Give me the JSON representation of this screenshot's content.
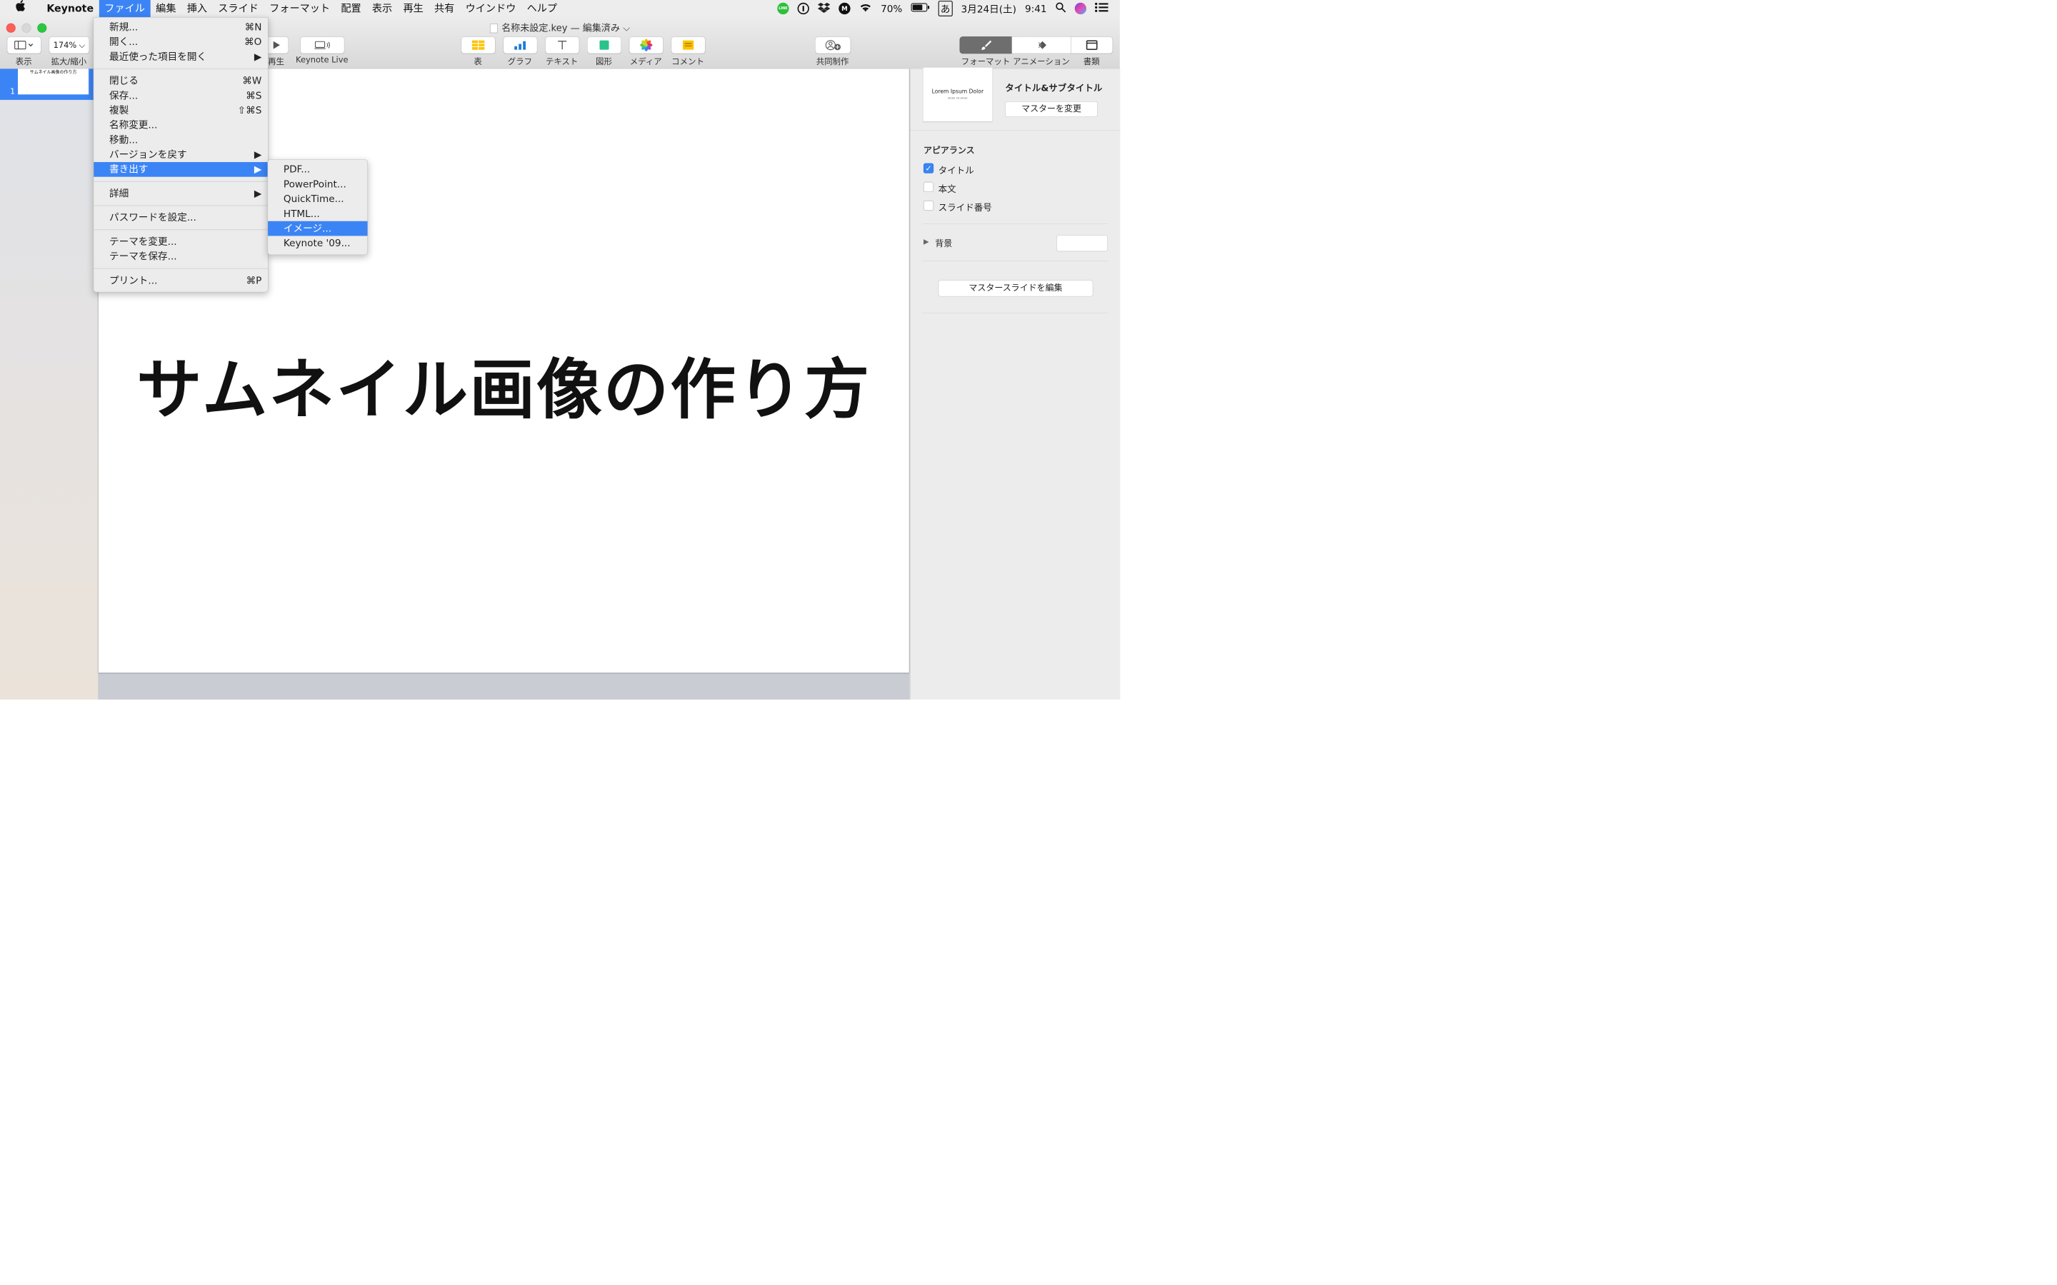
{
  "menubar": {
    "app": "Keynote",
    "items": [
      "ファイル",
      "編集",
      "挿入",
      "スライド",
      "フォーマット",
      "配置",
      "表示",
      "再生",
      "共有",
      "ウインドウ",
      "ヘルプ"
    ],
    "status": {
      "battery": "70%",
      "ime": "あ",
      "date": "3月24日(土)",
      "time": "9:41",
      "line_label": "LINE"
    }
  },
  "window": {
    "title": "名称未設定.key — 編集済み"
  },
  "toolbar": {
    "view_label": "表示",
    "zoom_value": "174%",
    "zoom_label": "拡大/縮小",
    "play_label": "再生",
    "keynote_live_label": "Keynote Live",
    "table_label": "表",
    "chart_label": "グラフ",
    "text_label": "テキスト",
    "shape_label": "図形",
    "media_label": "メディア",
    "comment_label": "コメント",
    "collab_label": "共同制作",
    "format_label": "フォーマット",
    "animation_label": "アニメーション",
    "document_label": "書類"
  },
  "navigator": {
    "slide_number": "1",
    "thumb_text": "サムネイル画像の作り方"
  },
  "slide": {
    "title": "サムネイル画像の作り方"
  },
  "inspector": {
    "master_thumb_title": "Lorem Ipsum Dolor",
    "master_thumb_sub": "Dolor sit amet",
    "master_name": "タイトル&サブタイトル",
    "change_master": "マスターを変更",
    "appearance": "アピアランス",
    "title_opt": "タイトル",
    "body_opt": "本文",
    "slide_number_opt": "スライド番号",
    "background": "背景",
    "edit_master": "マスタースライドを編集"
  },
  "file_menu": {
    "items": [
      {
        "label": "新規...",
        "shortcut": "⌘N"
      },
      {
        "label": "開く...",
        "shortcut": "⌘O"
      },
      {
        "label": "最近使った項目を開く",
        "shortcut": "▶"
      },
      {
        "label": "閉じる",
        "shortcut": "⌘W"
      },
      {
        "label": "保存...",
        "shortcut": "⌘S"
      },
      {
        "label": "複製",
        "shortcut": "⇧⌘S"
      },
      {
        "label": "名称変更...",
        "shortcut": ""
      },
      {
        "label": "移動...",
        "shortcut": ""
      },
      {
        "label": "バージョンを戻す",
        "shortcut": "▶"
      },
      {
        "label": "書き出す",
        "shortcut": "▶"
      },
      {
        "label": "詳細",
        "shortcut": "▶"
      },
      {
        "label": "パスワードを設定...",
        "shortcut": ""
      },
      {
        "label": "テーマを変更...",
        "shortcut": ""
      },
      {
        "label": "テーマを保存...",
        "shortcut": ""
      },
      {
        "label": "プリント...",
        "shortcut": "⌘P"
      }
    ]
  },
  "export_menu": {
    "items": [
      "PDF...",
      "PowerPoint...",
      "QuickTime...",
      "HTML...",
      "イメージ...",
      "Keynote '09..."
    ]
  }
}
